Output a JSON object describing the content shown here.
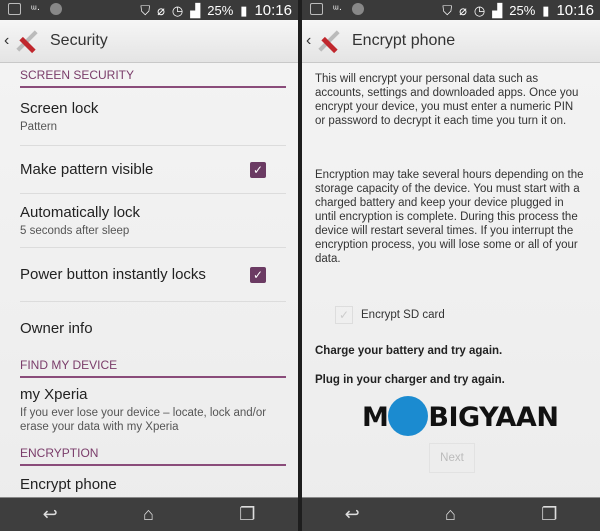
{
  "status_bar": {
    "battery": "25%",
    "time": "10:16"
  },
  "left": {
    "title": "Security",
    "sections": [
      {
        "header": "SCREEN SECURITY",
        "items": [
          {
            "title": "Screen lock",
            "subtitle": "Pattern",
            "checked": null
          },
          {
            "title": "Make pattern visible",
            "checked": true
          },
          {
            "title": "Automatically lock",
            "subtitle": "5 seconds after sleep"
          },
          {
            "title": "Power button instantly locks",
            "checked": true
          },
          {
            "title": "Owner info"
          }
        ]
      },
      {
        "header": "FIND MY DEVICE",
        "items": [
          {
            "title": "my Xperia",
            "subtitle": "If you ever lose your device – locate, lock and/or erase your data with my Xperia"
          }
        ]
      },
      {
        "header": "ENCRYPTION",
        "items": [
          {
            "title": "Encrypt phone"
          }
        ]
      }
    ]
  },
  "right": {
    "title": "Encrypt phone",
    "paragraph1": "This will encrypt your personal data such as accounts, settings and downloaded apps. Once you encrypt your device, you must enter a numeric PIN or password to decrypt it each time you turn it on.",
    "paragraph2": "Encryption may take several hours depending on the storage capacity of the device. You must start with a charged battery and keep your device plugged in until encryption is complete. During this process the device will restart several times. If you interrupt the encryption process, you will lose some or all of your data.",
    "sd_label": "Encrypt SD card",
    "warning1": "Charge your battery and try again.",
    "warning2": "Plug in your charger and try again.",
    "next_label": "Next",
    "watermark": "MOBIGYAAN"
  },
  "colors": {
    "accent": "#7a3c6a",
    "checkbox": "#6b3b63",
    "statusbar": "#3a3a3a"
  }
}
